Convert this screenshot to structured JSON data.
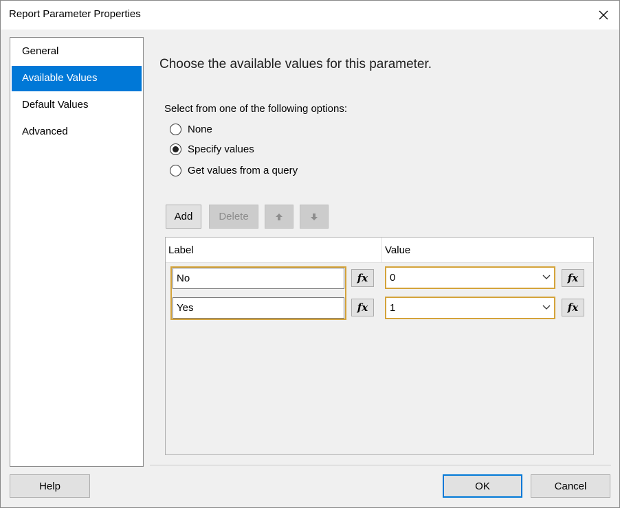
{
  "window": {
    "title": "Report Parameter Properties"
  },
  "nav": {
    "items": [
      {
        "label": "General"
      },
      {
        "label": "Available Values"
      },
      {
        "label": "Default Values"
      },
      {
        "label": "Advanced"
      }
    ],
    "selected": "Available Values"
  },
  "main": {
    "heading": "Choose the available values for this parameter.",
    "options_label": "Select from one of the following options:",
    "options": [
      {
        "label": "None",
        "checked": false
      },
      {
        "label": "Specify values",
        "checked": true
      },
      {
        "label": "Get values from a query",
        "checked": false
      }
    ],
    "toolbar": {
      "add": "Add",
      "delete": "Delete",
      "move_up_icon": "arrow-up-icon",
      "move_down_icon": "arrow-down-icon"
    },
    "grid": {
      "columns": [
        "Label",
        "Value"
      ],
      "rows": [
        {
          "label": "No",
          "value": "0"
        },
        {
          "label": "Yes",
          "value": "1"
        }
      ],
      "expression_button": "fx"
    }
  },
  "footer": {
    "help": "Help",
    "ok": "OK",
    "cancel": "Cancel"
  },
  "colors": {
    "accent": "#0078d7",
    "focus_border": "#d4a33a"
  }
}
